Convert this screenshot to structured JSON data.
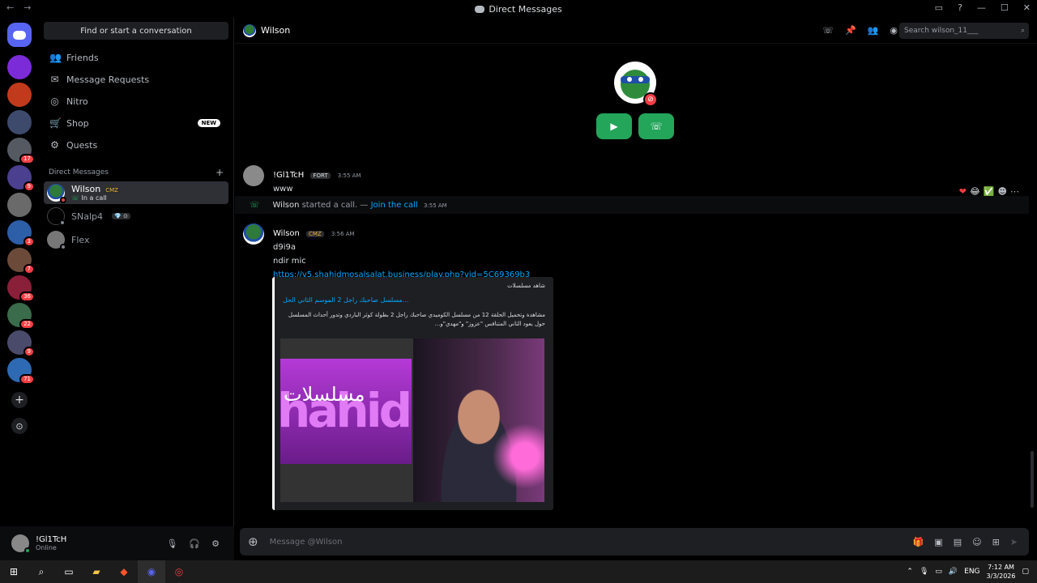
{
  "window": {
    "title": "Direct Messages",
    "back": "←",
    "forward": "→",
    "controls": [
      "▭",
      "?",
      "—",
      "☐",
      "✕"
    ]
  },
  "servers": [
    {
      "color": "#7c2bd9",
      "badge": ""
    },
    {
      "color": "#c23a1c",
      "badge": ""
    },
    {
      "color": "#3d4a6b",
      "badge": ""
    },
    {
      "color": "#555a62",
      "badge": "17"
    },
    {
      "color": "#4b3f8f",
      "badge": "9"
    },
    {
      "color": "#6a6a6a",
      "badge": ""
    },
    {
      "color": "#2d5ea8",
      "badge": "3"
    },
    {
      "color": "#6b4a3a",
      "badge": "7"
    },
    {
      "color": "#8a1f3a",
      "badge": "36"
    },
    {
      "color": "#3a6b4a",
      "badge": "22"
    },
    {
      "color": "#4a4a6b",
      "badge": "9"
    },
    {
      "color": "#2d6ab3",
      "badge": "71"
    }
  ],
  "sidebar": {
    "find_label": "Find or start a conversation",
    "nav": [
      {
        "label": "Friends",
        "icon": "👥"
      },
      {
        "label": "Message Requests",
        "icon": "✉"
      },
      {
        "label": "Nitro",
        "icon": "◎"
      },
      {
        "label": "Shop",
        "icon": "🛒",
        "badge": "NEW"
      },
      {
        "label": "Quests",
        "icon": "⚙"
      }
    ],
    "dm_header": "Direct Messages",
    "dm_add": "+",
    "dms": [
      {
        "name": "Wilson",
        "tag": "CMZ",
        "sub": "In a call"
      },
      {
        "name": "SNalp4",
        "tag": "💎 ⊙",
        "sub": ""
      },
      {
        "name": "Flex",
        "tag": "",
        "sub": ""
      }
    ]
  },
  "user_panel": {
    "name": "!Gl1TcH",
    "status": "Online"
  },
  "header": {
    "name": "Wilson",
    "search_placeholder": "Search wilson_11___"
  },
  "messages": [
    {
      "author": "!Gl1TcH",
      "tag": "FORT",
      "time": "3:55 AM",
      "lines": [
        "www"
      ]
    },
    {
      "author": "Wilson",
      "tag": "CMZ",
      "time": "3:56 AM",
      "lines": [
        "d9i9a",
        "ndir mic"
      ],
      "link": "https://v5.shahidmosalsalat.business/play.php?vid=5C69369b3"
    }
  ],
  "system": {
    "author": "Wilson",
    "text": "started a call. —",
    "link": "Join the call",
    "time": "3:55 AM"
  },
  "reactions": [
    "❤",
    "😂",
    "✅",
    "☻",
    "⋯"
  ],
  "embed": {
    "site": "شاهد مسلسلات",
    "title": "مسلسل صاحبك راجل 2 الموسم الثاني الحل...",
    "desc": "مشاهدة وتحميل الحلقة 12 من مسلسل الكوميدي صاحبك راجل 2 بطولة كوثر الباردي وتدور أحداث المسلسل حول يعود الثاني المتنافس \"عزوز\" و\"مهدي\"و...",
    "thumb_text": "مسلسلات",
    "thumb_brand": "hahid"
  },
  "composer": {
    "placeholder": "Message @Wilson"
  },
  "taskbar": {
    "lang": "ENG",
    "time": "7:12 AM",
    "date": "3/3/2026"
  }
}
